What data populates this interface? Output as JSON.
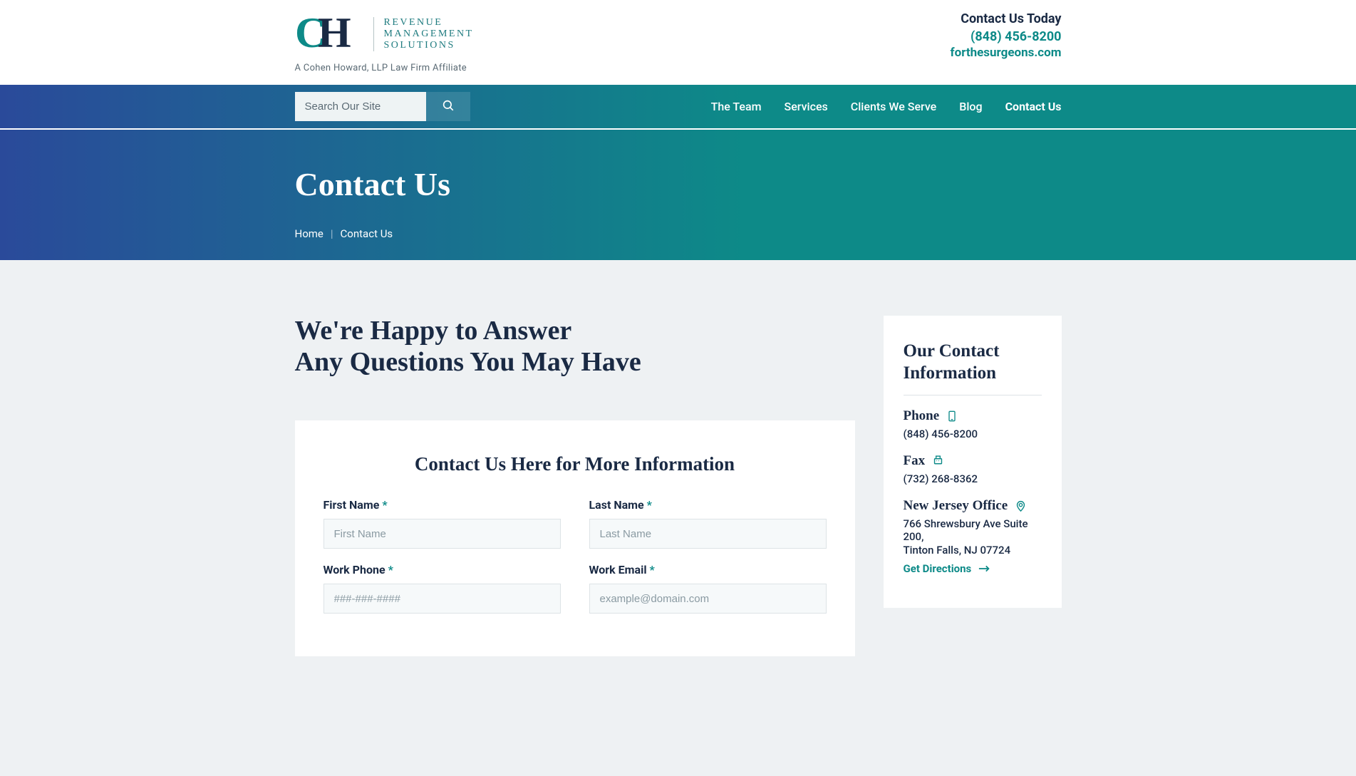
{
  "header": {
    "logo_line1": "REVENUE",
    "logo_line2": "MANAGEMENT",
    "logo_line3": "SOLUTIONS",
    "logo_sub": "A Cohen Howard, LLP Law Firm Affiliate",
    "contact_title": "Contact Us Today",
    "phone": "(848) 456-8200",
    "url": "forthesurgeons.com"
  },
  "nav": {
    "search_placeholder": "Search Our Site",
    "links": [
      "The Team",
      "Services",
      "Clients We Serve",
      "Blog",
      "Contact Us"
    ]
  },
  "hero": {
    "title": "Contact Us",
    "breadcrumb_home": "Home",
    "breadcrumb_current": "Contact Us"
  },
  "main": {
    "heading_line1": "We're Happy to Answer",
    "heading_line2": "Any Questions You May Have",
    "form_title": "Contact Us Here for More Information",
    "first_name_label": "First Name",
    "first_name_placeholder": "First Name",
    "last_name_label": "Last Name",
    "last_name_placeholder": "Last Name",
    "work_phone_label": "Work Phone",
    "work_phone_placeholder": "###-###-####",
    "work_email_label": "Work Email",
    "work_email_placeholder": "example@domain.com",
    "required": "*"
  },
  "sidebar": {
    "title": "Our Contact Information",
    "phone_label": "Phone",
    "phone_value": "(848) 456-8200",
    "fax_label": "Fax",
    "fax_value": "(732) 268-8362",
    "office_label": "New Jersey Office",
    "address_line1": "766 Shrewsbury Ave Suite 200,",
    "address_line2": "Tinton Falls, NJ 07724",
    "directions": "Get Directions"
  }
}
